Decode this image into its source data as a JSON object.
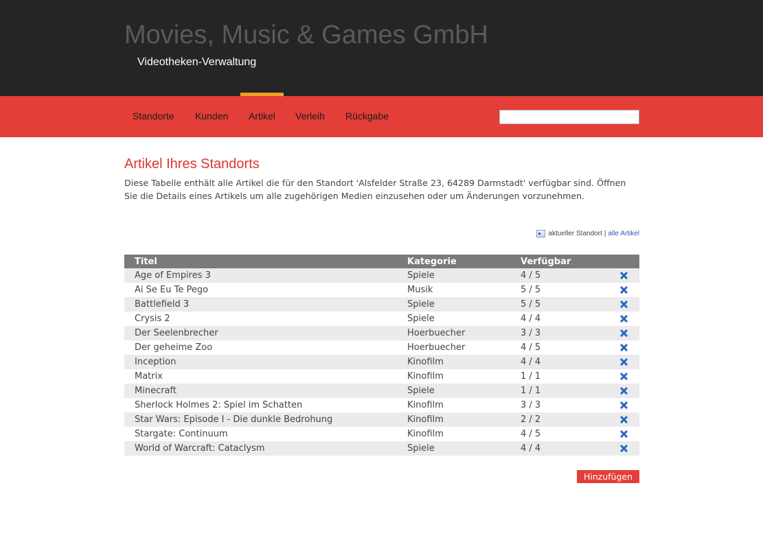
{
  "header": {
    "title": "Movies, Music & Games GmbH",
    "subtitle": "Videotheken-Verwaltung"
  },
  "nav": {
    "items": [
      {
        "label": "Standorte"
      },
      {
        "label": "Kunden"
      },
      {
        "label": "Artikel"
      },
      {
        "label": "Verleih"
      },
      {
        "label": "Rückgabe"
      }
    ],
    "active": "Artikel",
    "search_value": ""
  },
  "main": {
    "title": "Artikel Ihres Standorts",
    "description_line1": "Diese Tabelle enthält alle Artikel die für den Standort 'Alsfelder Straße 23, 64289 Darmstadt' verfügbar sind.",
    "description_line2": "Öffnen Sie die Details eines Artikels um alle zugehörigen Medien einzusehen oder um Änderungen vorzunehmen.",
    "filter": {
      "current_label": "aktueller Standort",
      "separator": "|",
      "all_label": "alle Artikel"
    },
    "table": {
      "headers": [
        "Titel",
        "Kategorie",
        "Verfügbar"
      ],
      "rows": [
        {
          "title": "Age of Empires 3",
          "category": "Spiele",
          "available": "4 / 5"
        },
        {
          "title": "Ai Se Eu Te Pego",
          "category": "Musik",
          "available": "5 / 5"
        },
        {
          "title": "Battlefield 3",
          "category": "Spiele",
          "available": "5 / 5"
        },
        {
          "title": "Crysis 2",
          "category": "Spiele",
          "available": "4 / 4"
        },
        {
          "title": "Der Seelenbrecher",
          "category": "Hoerbuecher",
          "available": "3 / 3"
        },
        {
          "title": "Der geheime Zoo",
          "category": "Hoerbuecher",
          "available": "4 / 5"
        },
        {
          "title": "Inception",
          "category": "Kinofilm",
          "available": "4 / 4"
        },
        {
          "title": "Matrix",
          "category": "Kinofilm",
          "available": "1 / 1"
        },
        {
          "title": "Minecraft",
          "category": "Spiele",
          "available": "1 / 1"
        },
        {
          "title": "Sherlock Holmes 2: Spiel im Schatten",
          "category": "Kinofilm",
          "available": "3 / 3"
        },
        {
          "title": "Star Wars: Episode I - Die dunkle Bedrohung",
          "category": "Kinofilm",
          "available": "2 / 2"
        },
        {
          "title": "Stargate: Continuum",
          "category": "Kinofilm",
          "available": "4 / 5"
        },
        {
          "title": "World of Warcraft: Cataclysm",
          "category": "Spiele",
          "available": "4 / 4"
        }
      ],
      "delete_icon": "delete-x-icon"
    },
    "add_button": "Hinzufügen"
  },
  "colors": {
    "header_bg": "#252525",
    "nav_bg": "#e43e38",
    "active_marker": "#f0a020",
    "title_red": "#d9372f",
    "delete_blue": "#2a66c8"
  }
}
